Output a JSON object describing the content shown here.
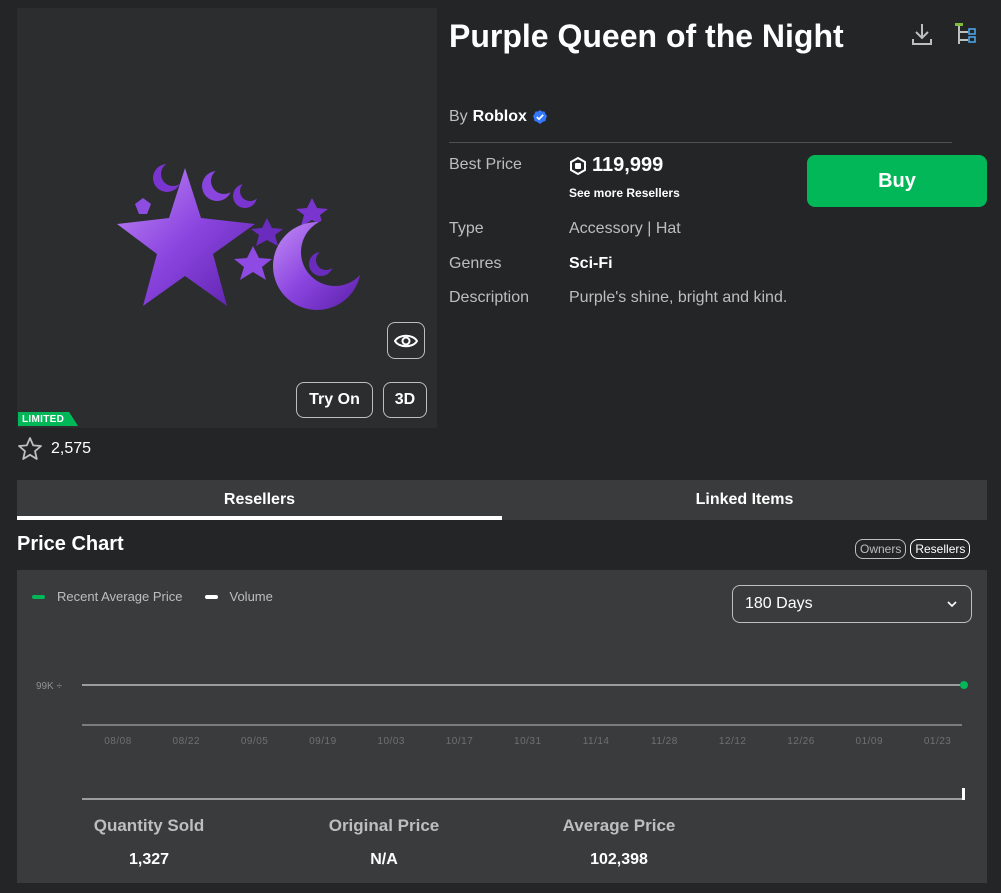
{
  "item": {
    "title": "Purple Queen of the Night",
    "by_prefix": "By",
    "creator": "Roblox",
    "badge": "LIMITED",
    "favorites": "2,575"
  },
  "thumbnail": {
    "try_on_label": "Try On",
    "three_d_label": "3D"
  },
  "details": {
    "best_price_label": "Best Price",
    "best_price": "119,999",
    "see_more": "See more Resellers",
    "buy_label": "Buy",
    "type_label": "Type",
    "type_value": "Accessory | Hat",
    "genres_label": "Genres",
    "genres_value": "Sci-Fi",
    "description_label": "Description",
    "description_value": "Purple's shine, bright and kind."
  },
  "tabs": [
    {
      "label": "Resellers",
      "active": true
    },
    {
      "label": "Linked Items",
      "active": false
    }
  ],
  "price_chart": {
    "title": "Price Chart",
    "toggles": [
      {
        "label": "Owners",
        "active": false
      },
      {
        "label": "Resellers",
        "active": true
      }
    ],
    "legend": [
      {
        "label": "Recent Average Price",
        "color": "#02b757"
      },
      {
        "label": "Volume",
        "color": "#ffffff"
      }
    ],
    "range": "180 Days"
  },
  "chart_data": {
    "type": "line",
    "ytick_labels": [
      "99K"
    ],
    "categories": [
      "08/08",
      "08/22",
      "09/05",
      "09/19",
      "10/03",
      "10/17",
      "10/31",
      "11/14",
      "11/28",
      "12/12",
      "12/26",
      "01/09",
      "01/23"
    ],
    "series": [
      {
        "name": "Recent Average Price",
        "values": [
          99000,
          99000,
          99000,
          99000,
          99000,
          99000,
          99000,
          99000,
          99000,
          99000,
          99000,
          99000,
          99000
        ],
        "color": "#02b757"
      },
      {
        "name": "Volume",
        "color": "#ffffff"
      }
    ],
    "legend": "top-left"
  },
  "stats": [
    {
      "label": "Quantity Sold",
      "value": "1,327"
    },
    {
      "label": "Original Price",
      "value": "N/A"
    },
    {
      "label": "Average Price",
      "value": "102,398"
    }
  ],
  "colors": {
    "accent": "#02b757",
    "background": "#232527",
    "panel": "#393b3d",
    "verified": "#3377ff"
  },
  "icons": [
    "eye-icon",
    "star-icon",
    "download-icon",
    "hierarchy-icon",
    "verified-icon",
    "robux-icon",
    "chevron-down-icon"
  ]
}
